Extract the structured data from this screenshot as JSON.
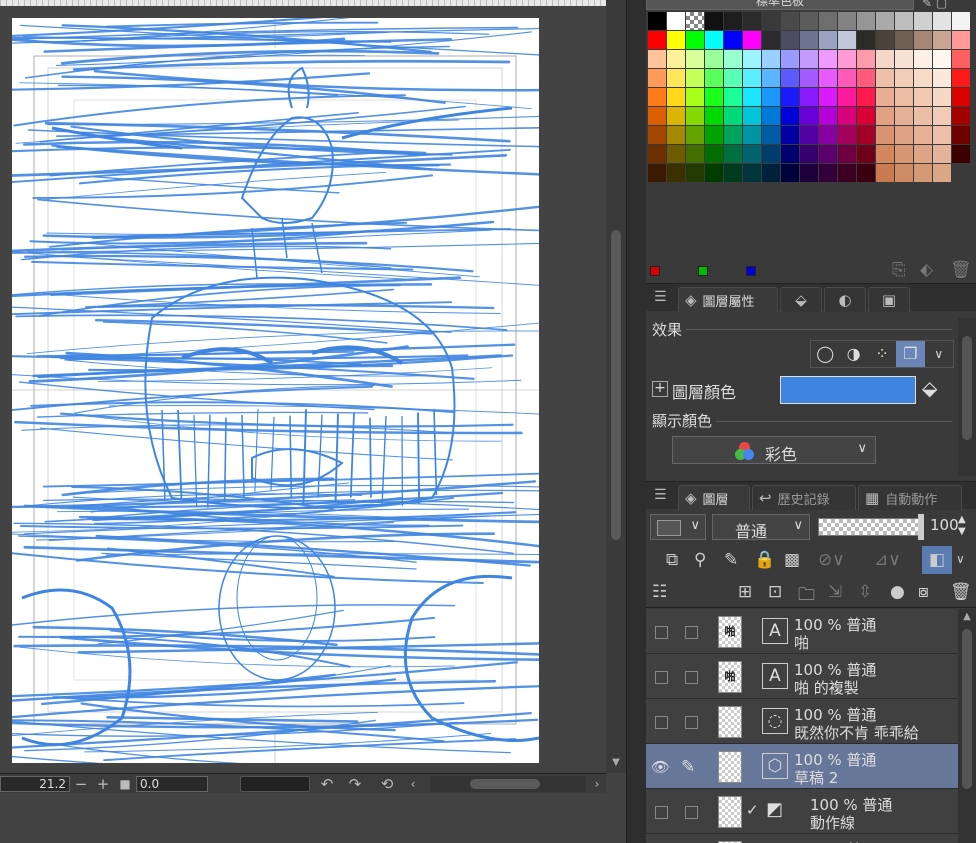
{
  "canvas": {
    "zoom": "21.2",
    "rotation": "0.0"
  },
  "color_set": {
    "name": "標準色板",
    "swatches": [
      "#000000",
      "#ffffff",
      "checker",
      "#111111",
      "#1e1e1e",
      "#2b2b2b",
      "#3a3a3a",
      "#4a4a4a",
      "#5c5c5c",
      "#6e6e6e",
      "#828282",
      "#969696",
      "#aaaaaa",
      "#bdbdbd",
      "#d0d0d0",
      "#e3e3e3",
      "#f3f3f3",
      "#ff0000",
      "#ffff00",
      "#00ff00",
      "#00ffff",
      "#0000ff",
      "#ff00ff",
      "#2a2a30",
      "#4a4e60",
      "#6c7390",
      "#9aa3c0",
      "#c1c6d9",
      "#2e2a26",
      "#4b423a",
      "#6e5f52",
      "#a88676",
      "#c9a592",
      "#ff9a9a",
      "#ffc49a",
      "#fff29a",
      "#d8ff9a",
      "#9aff9a",
      "#9affd0",
      "#9af5ff",
      "#9ad0ff",
      "#9a9aff",
      "#c49aff",
      "#f09aff",
      "#ff9ad4",
      "#ff9aaa",
      "#f5d6c8",
      "#f8e2d6",
      "#fbefe6",
      "#fff7f0",
      "#ff5f5f",
      "#ff9a5a",
      "#ffe65a",
      "#c4ff5a",
      "#5aff5a",
      "#5affb4",
      "#5aeeff",
      "#5ab4ff",
      "#5a5aff",
      "#a45aff",
      "#e65aff",
      "#ff5ab9",
      "#ff5a7a",
      "#eec0aa",
      "#f2cdb8",
      "#f6dbc9",
      "#fae8dc",
      "#ff1a1a",
      "#ff7a1a",
      "#ffd91a",
      "#a8ff1a",
      "#1aff1a",
      "#1aff98",
      "#1ae6ff",
      "#1a98ff",
      "#1a1aff",
      "#871aff",
      "#d91aff",
      "#ff1a9d",
      "#ff1a4e",
      "#e8ad94",
      "#edbca2",
      "#f1cab3",
      "#f5d8c6",
      "#d90000",
      "#d95f00",
      "#d9b500",
      "#86d900",
      "#00d900",
      "#00d97a",
      "#00c4d9",
      "#007ad9",
      "#0000d9",
      "#6a00d9",
      "#b500d9",
      "#d9007c",
      "#d90036",
      "#e0a184",
      "#e6b096",
      "#ebbea7",
      "#f0ccb8",
      "#a30000",
      "#a34700",
      "#a38800",
      "#65a300",
      "#00a300",
      "#00a35c",
      "#0093a3",
      "#005ca3",
      "#0000a3",
      "#5000a3",
      "#8800a3",
      "#a3005d",
      "#a30029",
      "#d99272",
      "#dfa285",
      "#e5b097",
      "#ebbfa9",
      "#6e0000",
      "#6e3000",
      "#6e5c00",
      "#446e00",
      "#006e00",
      "#006e3e",
      "#00636e",
      "#003e6e",
      "#00006e",
      "#36006e",
      "#5c006e",
      "#6e003f",
      "#6e001c",
      "#d4865f",
      "#d99673",
      "#dea488",
      "#e4b39b",
      "#3b0000",
      "#3b1a00",
      "#3b3100",
      "#243b00",
      "#003b00",
      "#003b21",
      "#00353b",
      "#00213b",
      "#00003b",
      "#1d003b",
      "#31003b",
      "#3b0022",
      "#3b000f",
      "#c97a52",
      "#cf8b63",
      "#d49975",
      "#daa886"
    ]
  },
  "tabs": {
    "property_panel": {
      "active_label": "圖層屬性"
    },
    "layer_panel": {
      "layer_label": "圖層",
      "history_label": "歷史記錄",
      "auto_action_label": "自動動作"
    }
  },
  "layer_property": {
    "effect_title": "效果",
    "layer_color_label": "圖層顏色",
    "layer_color_value": "#3f85e0",
    "display_color_title": "顯示顏色",
    "display_color_value": "彩色"
  },
  "layer_panel": {
    "blend_mode": "普通",
    "opacity": "100",
    "layers": [
      {
        "percent_mode": "100 % 普通",
        "name": "啪",
        "thumb_text": "啪",
        "visible": false,
        "selected": false
      },
      {
        "percent_mode": "100 % 普通",
        "name": "啪 的複製",
        "thumb_text": "啪",
        "visible": false,
        "selected": false
      },
      {
        "percent_mode": "100 % 普通",
        "name": "既然你不肯 乖乖給",
        "thumb_text": "",
        "visible": false,
        "selected": false
      },
      {
        "percent_mode": "100 % 普通",
        "name": "草稿 2",
        "thumb_text": "",
        "visible": true,
        "selected": true
      },
      {
        "percent_mode": "100 % 普通",
        "name": "動作線",
        "thumb_text": "",
        "visible": false,
        "selected": false
      },
      {
        "percent_mode": "100 % 普通",
        "name": "",
        "thumb_text": "",
        "visible": false,
        "selected": false
      }
    ]
  },
  "colors": {
    "sketch_blue": "#3f85e0",
    "panel_bg": "#3a3a3a",
    "selected_row": "#667799"
  }
}
